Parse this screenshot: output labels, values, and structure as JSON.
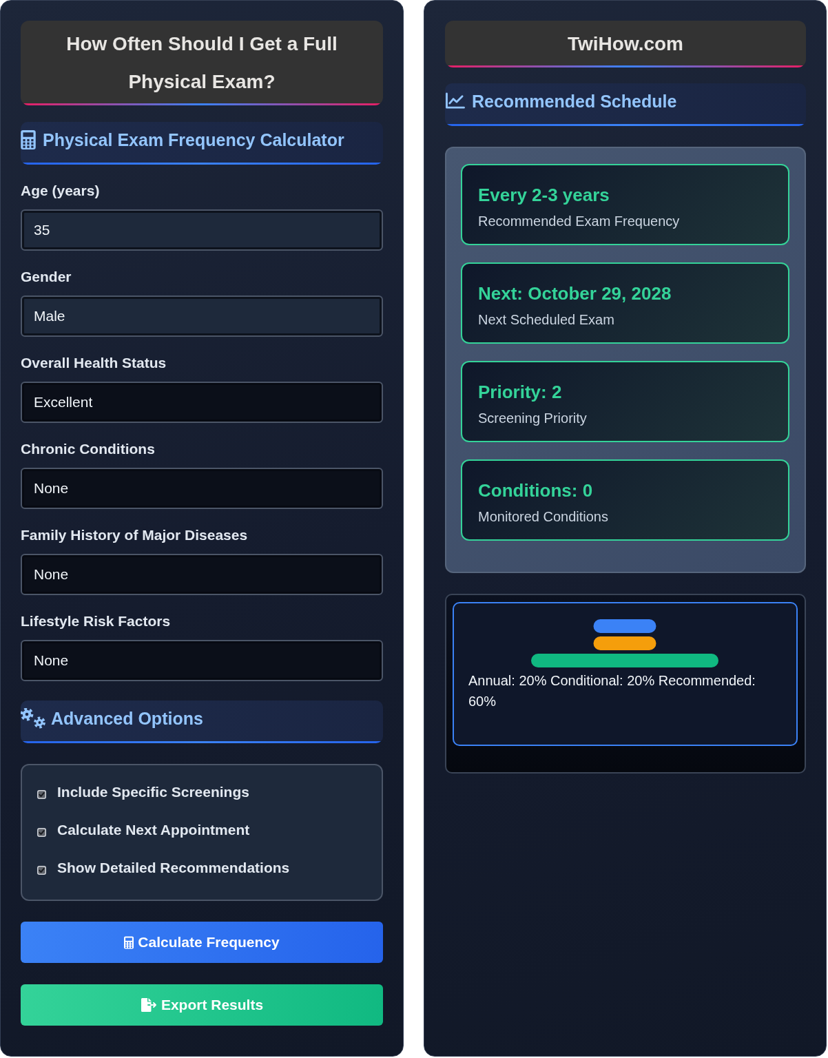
{
  "form_panel": {
    "title": "How Often Should I Get a Full Physical Exam?",
    "calculator_heading": "Physical Exam Frequency Calculator",
    "fields": [
      {
        "label": "Age (years)",
        "value": "35"
      },
      {
        "label": "Gender",
        "value": "Male"
      },
      {
        "label": "Overall Health Status",
        "value": "Excellent"
      },
      {
        "label": "Chronic Conditions",
        "value": "None"
      },
      {
        "label": "Family History of Major Diseases",
        "value": "None"
      },
      {
        "label": "Lifestyle Risk Factors",
        "value": "None"
      }
    ],
    "advanced_heading": "Advanced Options",
    "options": [
      {
        "label": "Include Specific Screenings",
        "checked": true
      },
      {
        "label": "Calculate Next Appointment",
        "checked": true
      },
      {
        "label": "Show Detailed Recommendations",
        "checked": true
      }
    ],
    "buttons": [
      {
        "label": "Calculate Frequency",
        "kind": "primary"
      },
      {
        "label": "Export Results",
        "kind": "success"
      }
    ]
  },
  "results_panel": {
    "site_name": "TwiHow.com",
    "heading": "Recommended Schedule",
    "results": [
      {
        "value": "Every 2-3 years",
        "label": "Recommended Exam Frequency"
      },
      {
        "value": "Next: October 29, 2028",
        "label": "Next Scheduled Exam"
      },
      {
        "value": "Priority: 2",
        "label": "Screening Priority"
      },
      {
        "value": "Conditions: 0",
        "label": "Monitored Conditions"
      }
    ],
    "chart": {
      "caption": "Annual: 20% Conditional: 20% Recommended: 60%"
    }
  }
}
